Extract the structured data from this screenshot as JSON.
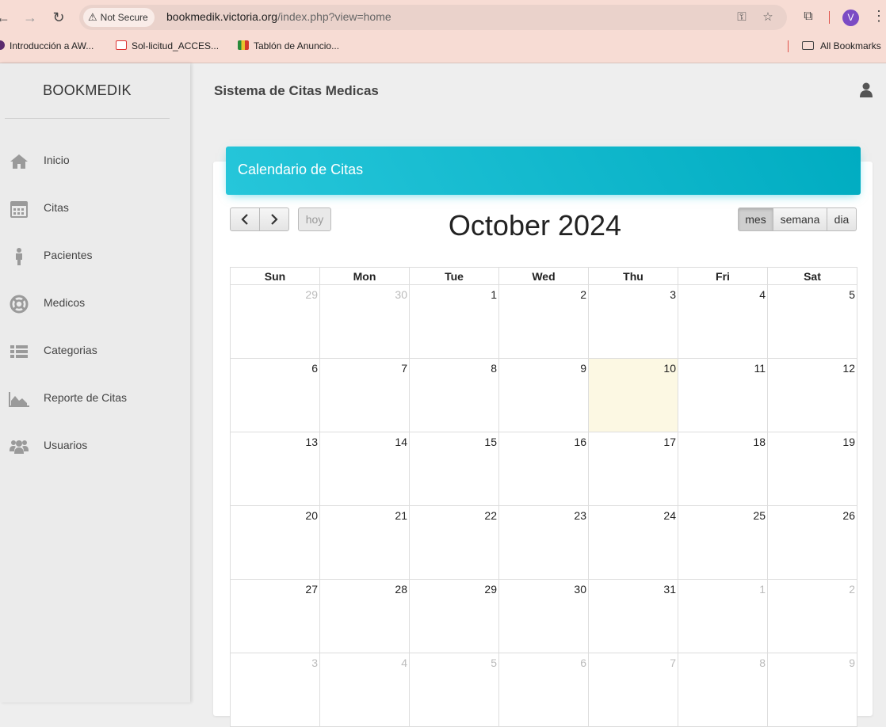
{
  "browser": {
    "security_label": "Not Secure",
    "url_host": "bookmedik.victoria.org",
    "url_path": "/index.php?view=home",
    "profile_initial": "V",
    "bookmarks": [
      {
        "label": "Introducción a AW..."
      },
      {
        "label": "Sol-licitud_ACCES..."
      },
      {
        "label": "Tablón de Anuncio..."
      }
    ],
    "all_bookmarks_label": "All Bookmarks"
  },
  "sidebar": {
    "brand": "BOOKMEDIK",
    "items": [
      {
        "label": "Inicio",
        "icon": "home-icon"
      },
      {
        "label": "Citas",
        "icon": "calendar-icon"
      },
      {
        "label": "Pacientes",
        "icon": "person-icon"
      },
      {
        "label": "Medicos",
        "icon": "life-ring-icon"
      },
      {
        "label": "Categorias",
        "icon": "list-icon"
      },
      {
        "label": "Reporte de Citas",
        "icon": "area-chart-icon"
      },
      {
        "label": "Usuarios",
        "icon": "users-icon"
      }
    ]
  },
  "header": {
    "title": "Sistema de Citas Medicas"
  },
  "calendar": {
    "card_title": "Calendario de Citas",
    "today_button": "hoy",
    "view_buttons": [
      "mes",
      "semana",
      "dia"
    ],
    "active_view": "mes",
    "month_title": "October 2024",
    "weekdays": [
      "Sun",
      "Mon",
      "Tue",
      "Wed",
      "Thu",
      "Fri",
      "Sat"
    ],
    "today": 10,
    "weeks": [
      [
        {
          "d": "29",
          "o": true
        },
        {
          "d": "30",
          "o": true
        },
        {
          "d": "1"
        },
        {
          "d": "2"
        },
        {
          "d": "3"
        },
        {
          "d": "4"
        },
        {
          "d": "5"
        }
      ],
      [
        {
          "d": "6"
        },
        {
          "d": "7"
        },
        {
          "d": "8"
        },
        {
          "d": "9"
        },
        {
          "d": "10",
          "t": true
        },
        {
          "d": "11"
        },
        {
          "d": "12"
        }
      ],
      [
        {
          "d": "13"
        },
        {
          "d": "14"
        },
        {
          "d": "15"
        },
        {
          "d": "16"
        },
        {
          "d": "17"
        },
        {
          "d": "18"
        },
        {
          "d": "19"
        }
      ],
      [
        {
          "d": "20"
        },
        {
          "d": "21"
        },
        {
          "d": "22"
        },
        {
          "d": "23"
        },
        {
          "d": "24"
        },
        {
          "d": "25"
        },
        {
          "d": "26"
        }
      ],
      [
        {
          "d": "27"
        },
        {
          "d": "28"
        },
        {
          "d": "29"
        },
        {
          "d": "30"
        },
        {
          "d": "31"
        },
        {
          "d": "1",
          "o": true
        },
        {
          "d": "2",
          "o": true
        }
      ],
      [
        {
          "d": "3",
          "o": true
        },
        {
          "d": "4",
          "o": true
        },
        {
          "d": "5",
          "o": true
        },
        {
          "d": "6",
          "o": true
        },
        {
          "d": "7",
          "o": true
        },
        {
          "d": "8",
          "o": true
        },
        {
          "d": "9",
          "o": true
        }
      ]
    ]
  }
}
